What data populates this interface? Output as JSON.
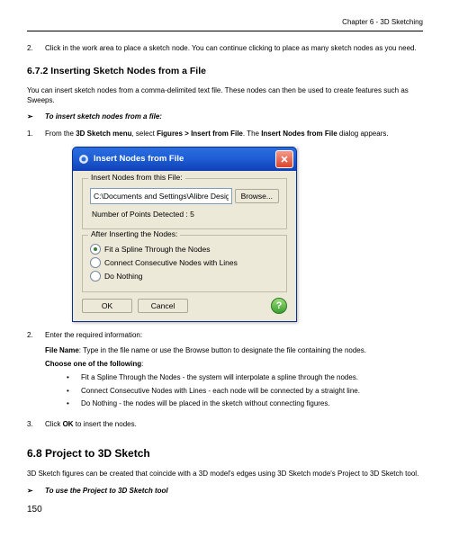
{
  "chapter_header": "Chapter 6 - 3D Sketching",
  "item2": {
    "num": "2.",
    "text": "Click in the work area to place a sketch node. You can continue clicking to place as many sketch nodes as you need."
  },
  "section_672": {
    "heading": "6.7.2   Inserting Sketch Nodes from a File",
    "intro": "You can insert sketch nodes from a comma-delimited text file. These nodes can then be used to create features such as Sweeps.",
    "sub_bullet": "➢",
    "sub_heading": "To insert sketch nodes from a file:",
    "step1_num": "1.",
    "step1_a": "From the ",
    "step1_b": "3D Sketch menu",
    "step1_c": ", select ",
    "step1_d": "Figures > Insert from File",
    "step1_e": ". The ",
    "step1_f": "Insert Nodes from File",
    "step1_g": " dialog appears."
  },
  "dialog": {
    "title": "Insert Nodes from File",
    "group1_label": "Insert Nodes from this File:",
    "path_value": "C:\\Documents and Settings\\Alibre Design W",
    "browse": "Browse...",
    "num_points": "Number of Points Detected : 5",
    "group2_label": "After Inserting the Nodes:",
    "opt1": "Fit a Spline Through the Nodes",
    "opt2": "Connect Consecutive Nodes with Lines",
    "opt3": "Do Nothing",
    "ok": "OK",
    "cancel": "Cancel",
    "help": "?"
  },
  "step2": {
    "num": "2.",
    "text": "Enter the required information:",
    "filename_label": "File Name",
    "filename_text": ": Type in the file name or use the Browse button to designate the file containing the nodes.",
    "choose_label": "Choose one of the following",
    "choose_colon": ":",
    "b1": "Fit a Spline Through the Nodes - the system will interpolate a spline through the nodes.",
    "b2": "Connect Consecutive Nodes with Lines - each node will be connected by a straight line.",
    "b3": "Do Nothing - the nodes will be placed in the sketch without connecting figures."
  },
  "step3": {
    "num": "3.",
    "a": "Click ",
    "b": "OK",
    "c": " to insert the nodes."
  },
  "section_68": {
    "heading": "6.8   Project to 3D Sketch",
    "intro": "3D Sketch figures can be created that coincide with a 3D model's edges using 3D Sketch mode's Project to 3D Sketch tool.",
    "sub_bullet": "➢",
    "sub_heading": "To use the Project to 3D Sketch tool"
  },
  "page_number": "150"
}
